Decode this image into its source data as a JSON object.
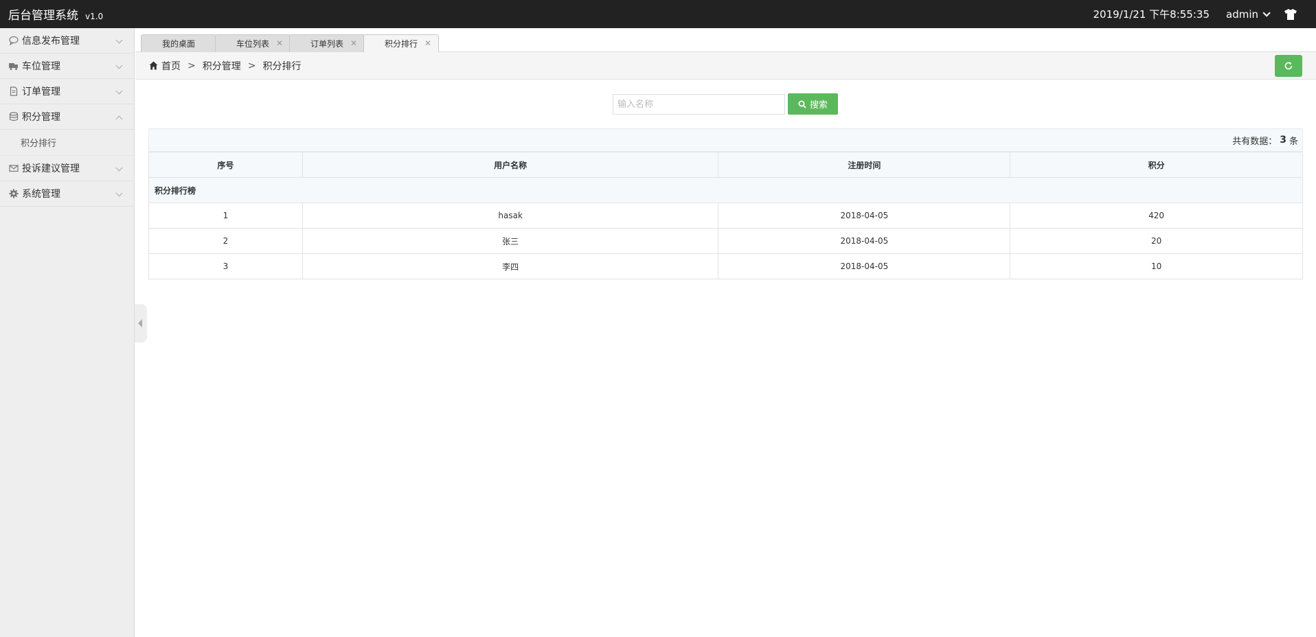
{
  "header": {
    "app_title": "后台管理系统",
    "version": "v1.0",
    "datetime": "2019/1/21 下午8:55:35",
    "user": "admin"
  },
  "sidebar": {
    "items": [
      {
        "label": "信息发布管理",
        "icon": "comment-icon"
      },
      {
        "label": "车位管理",
        "icon": "truck-icon"
      },
      {
        "label": "订单管理",
        "icon": "document-icon"
      },
      {
        "label": "积分管理",
        "icon": "database-icon",
        "expanded": true,
        "children": [
          "积分排行"
        ]
      },
      {
        "label": "投诉建议管理",
        "icon": "envelope-icon"
      },
      {
        "label": "系统管理",
        "icon": "gear-icon"
      }
    ]
  },
  "tabs": [
    {
      "label": "我的桌面"
    },
    {
      "label": "车位列表"
    },
    {
      "label": "订单列表"
    },
    {
      "label": "积分排行",
      "active": true
    }
  ],
  "breadcrumb": [
    "首页",
    "积分管理",
    "积分排行"
  ],
  "search": {
    "placeholder": "输入名称",
    "button_label": "搜索"
  },
  "count": {
    "prefix": "共有数据：",
    "value": "3",
    "suffix": "条"
  },
  "table": {
    "caption": "积分排行榜",
    "columns": [
      "序号",
      "用户名称",
      "注册时间",
      "积分"
    ],
    "rows": [
      [
        "1",
        "hasak",
        "2018-04-05",
        "420"
      ],
      [
        "2",
        "张三",
        "2018-04-05",
        "20"
      ],
      [
        "3",
        "李四",
        "2018-04-05",
        "10"
      ]
    ]
  },
  "colors": {
    "topbar": "#222222",
    "accent_green": "#5cb85c",
    "sidebar_bg": "#eeeeee"
  }
}
